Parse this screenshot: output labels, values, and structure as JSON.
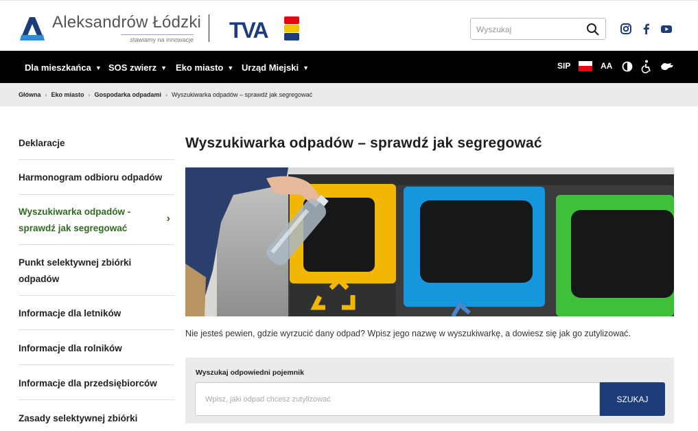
{
  "header": {
    "city_name": "Aleksandrów Łódzki",
    "tagline": "stawiamy na innowacje",
    "tva_logo_text": "TVA",
    "search_placeholder": "Wyszukaj",
    "social": [
      "instagram-icon",
      "facebook-icon",
      "youtube-icon"
    ]
  },
  "nav": {
    "items": [
      {
        "label": "Dla mieszkańca"
      },
      {
        "label": "SOS zwierz"
      },
      {
        "label": "Eko miasto"
      },
      {
        "label": "Urząd Miejski"
      }
    ],
    "tools": {
      "sip": "SIP",
      "font_size": "AA"
    }
  },
  "breadcrumb": [
    "Główna",
    "Eko miasto",
    "Gospodarka odpadami",
    "Wyszukiwarka odpadów – sprawdź jak segregować"
  ],
  "sidebar": {
    "items": [
      {
        "label": "Deklaracje",
        "active": false
      },
      {
        "label": "Harmonogram odbioru odpadów",
        "active": false
      },
      {
        "label": "Wyszukiwarka odpadów - sprawdź jak segregować",
        "active": true
      },
      {
        "label": "Punkt selektywnej zbiórki odpadów",
        "active": false
      },
      {
        "label": "Informacje dla letników",
        "active": false
      },
      {
        "label": "Informacje dla rolników",
        "active": false
      },
      {
        "label": "Informacje dla przedsiębiorców",
        "active": false
      },
      {
        "label": "Zasady selektywnej zbiórki",
        "active": false
      }
    ]
  },
  "main": {
    "title": "Wyszukiwarka odpadów – sprawdź jak segregować",
    "lead": "Nie jesteś pewien, gdzie wyrzucić dany odpad? Wpisz jego nazwę w wyszukiwarkę, a dowiesz się jak go zutylizować.",
    "finder": {
      "label": "Wyszukaj odpowiedni pojemnik",
      "placeholder": "Wpisz, jaki odpad chcesz zutylizować",
      "button": "SZUKAJ"
    }
  },
  "colors": {
    "accent_green": "#2f6b1e",
    "button_navy": "#1d3d7a",
    "nav_bg": "#000000"
  }
}
